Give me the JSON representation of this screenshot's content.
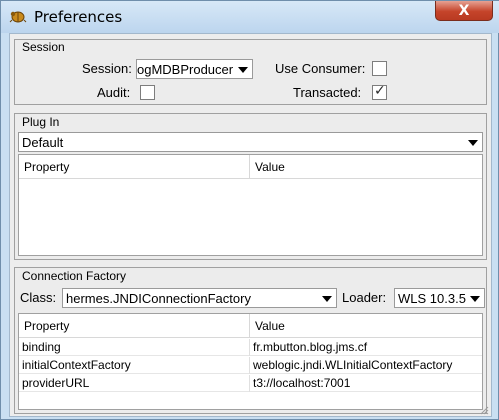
{
  "window": {
    "title": "Preferences",
    "close_glyph": "X",
    "close_color": "#c5442a",
    "icon": "beetle-icon"
  },
  "session": {
    "title": "Session",
    "session_label": "Session:",
    "session_value": "ogMDBProducer",
    "use_consumer_label": "Use Consumer:",
    "use_consumer_checked": false,
    "audit_label": "Audit:",
    "audit_checked": false,
    "transacted_label": "Transacted:",
    "transacted_checked": true
  },
  "plugin": {
    "title": "Plug In",
    "selected": "Default",
    "columns": [
      "Property",
      "Value"
    ],
    "rows": []
  },
  "connection_factory": {
    "title": "Connection Factory",
    "class_label": "Class:",
    "class_value": "hermes.JNDIConnectionFactory",
    "loader_label": "Loader:",
    "loader_value": "WLS 10.3.5",
    "columns": [
      "Property",
      "Value"
    ],
    "rows": [
      {
        "property": "binding",
        "value": "fr.mbutton.blog.jms.cf"
      },
      {
        "property": "initialContextFactory",
        "value": "weblogic.jndi.WLInitialContextFactory"
      },
      {
        "property": "providerURL",
        "value": "t3://localhost:7001"
      }
    ]
  }
}
